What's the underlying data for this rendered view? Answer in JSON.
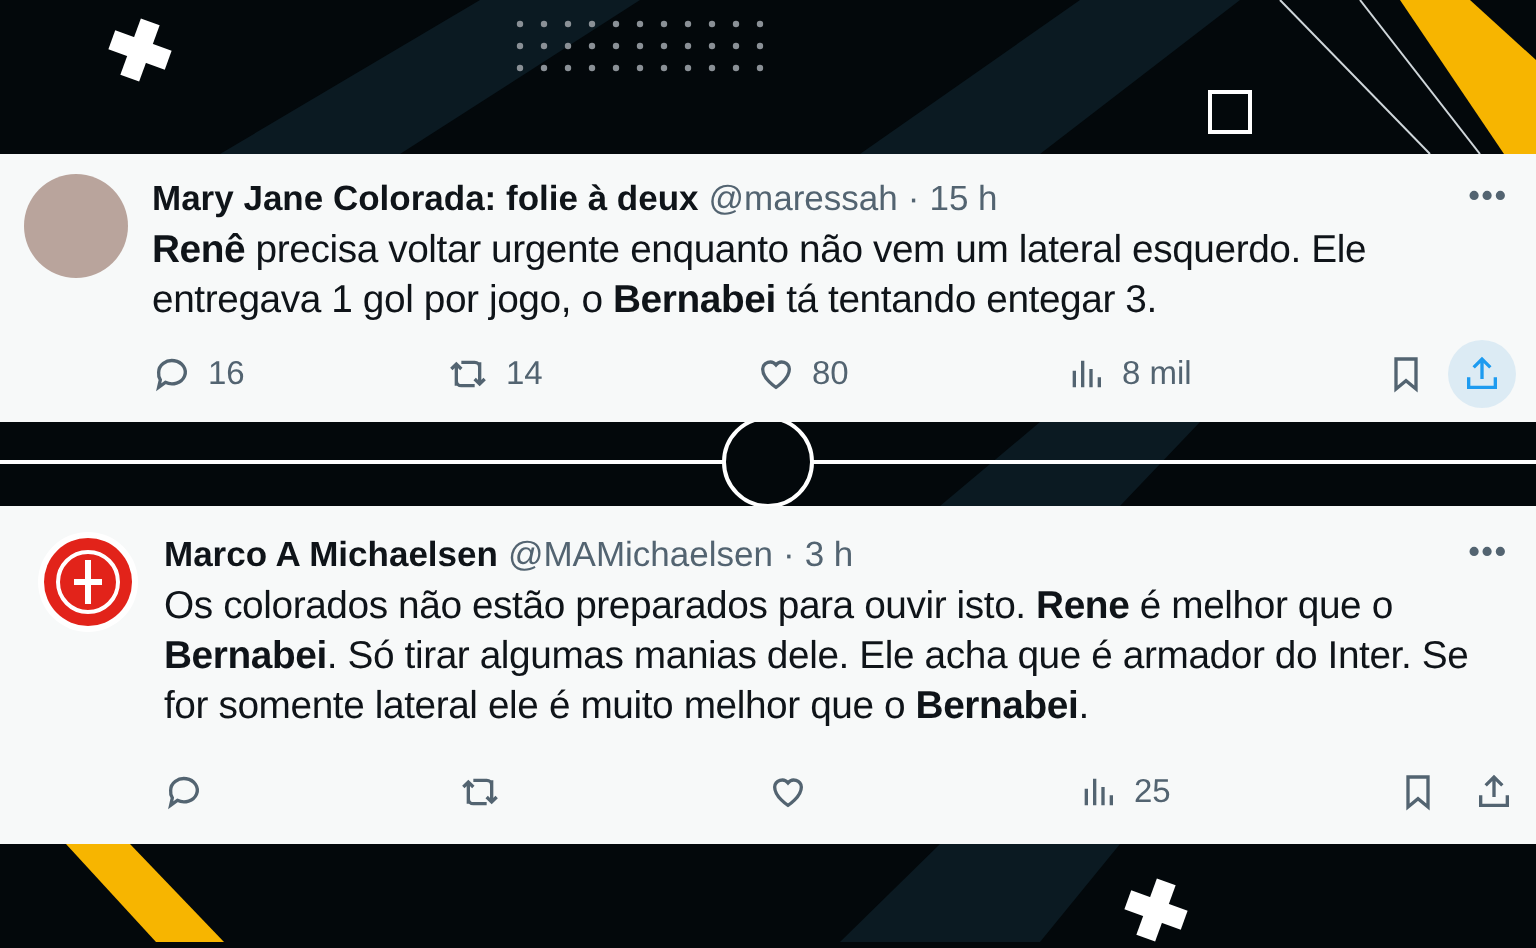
{
  "tweets": [
    {
      "name": "Mary Jane Colorada: folie à deux",
      "handle": "@maressah",
      "separator": "·",
      "time": "15 h",
      "more": "•••",
      "kind": "photo",
      "text": "**Renê** precisa voltar urgente enquanto não vem um lateral esquerdo. Ele entregava 1 gol por jogo, o **Bernabei** tá tentando entegar 3.",
      "replies": "16",
      "reposts": "14",
      "likes": "80",
      "views": "8 mil",
      "share_highlighted": true
    },
    {
      "name": "Marco A Michaelsen",
      "handle": "@MAMichaelsen",
      "separator": "·",
      "time": "3 h",
      "more": "•••",
      "kind": "crest",
      "text": "Os colorados não estão preparados para ouvir isto. **Rene** é melhor que o **Bernabei**. Só tirar algumas manias dele. Ele acha que é armador do Inter. Se for somente lateral ele é muito melhor que o **Bernabei**.",
      "views": "25",
      "share_highlighted": false
    }
  ]
}
